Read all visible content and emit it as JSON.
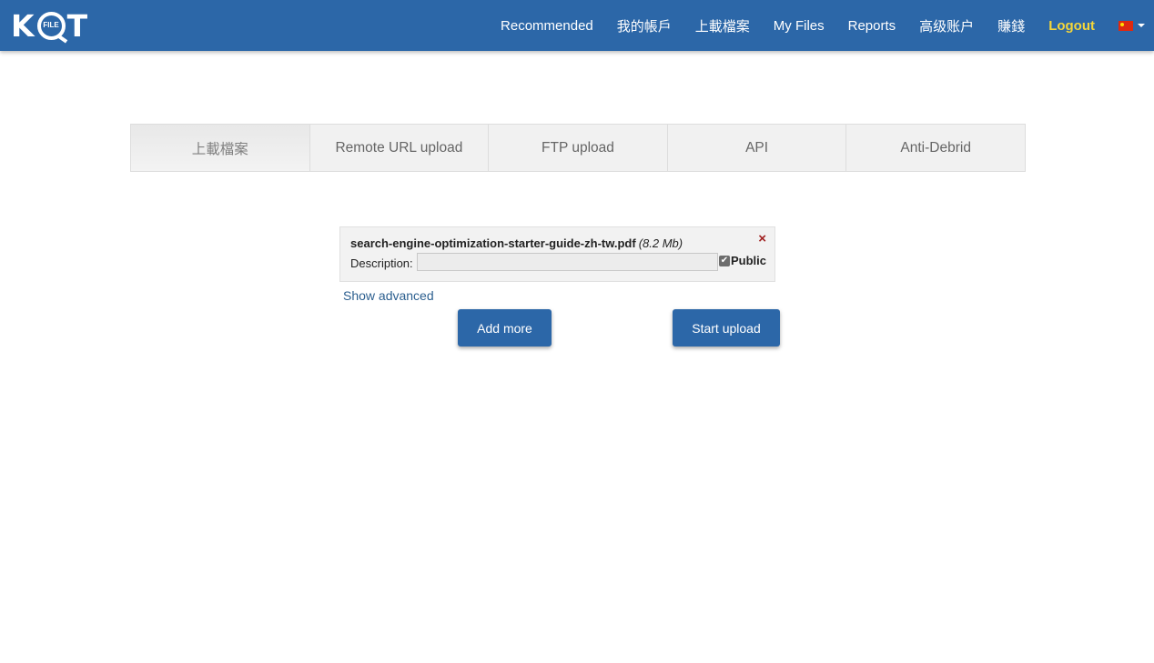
{
  "header": {
    "logo": {
      "left": "K",
      "ring": "FILE",
      "right": "T"
    },
    "nav": [
      {
        "label": "Recommended"
      },
      {
        "label": "我的帳戶"
      },
      {
        "label": "上載檔案"
      },
      {
        "label": "My Files"
      },
      {
        "label": "Reports"
      },
      {
        "label": "高级账户"
      },
      {
        "label": "賺錢"
      },
      {
        "label": "Logout"
      }
    ],
    "language": {
      "flag": "cn-flag-icon"
    }
  },
  "tabs": [
    {
      "label": "上載檔案",
      "active": true
    },
    {
      "label": "Remote URL upload",
      "active": false
    },
    {
      "label": "FTP upload",
      "active": false
    },
    {
      "label": "API",
      "active": false
    },
    {
      "label": "Anti-Debrid",
      "active": false
    }
  ],
  "upload": {
    "file_name": "search-engine-optimization-starter-guide-zh-tw.pdf",
    "file_size": "(8.2 Mb)",
    "remove_symbol": "×",
    "description_label": "Description:",
    "description_value": "",
    "public_label": "Public",
    "public_checked": true,
    "checkmark": "✔",
    "show_advanced": "Show advanced",
    "add_more": "Add more",
    "start_upload": "Start upload"
  },
  "colors": {
    "header_bg": "#2c67a8",
    "logout": "#f4d63a",
    "button_bg": "#2c67a8",
    "link": "#2c5f8f",
    "remove": "#a02020"
  }
}
